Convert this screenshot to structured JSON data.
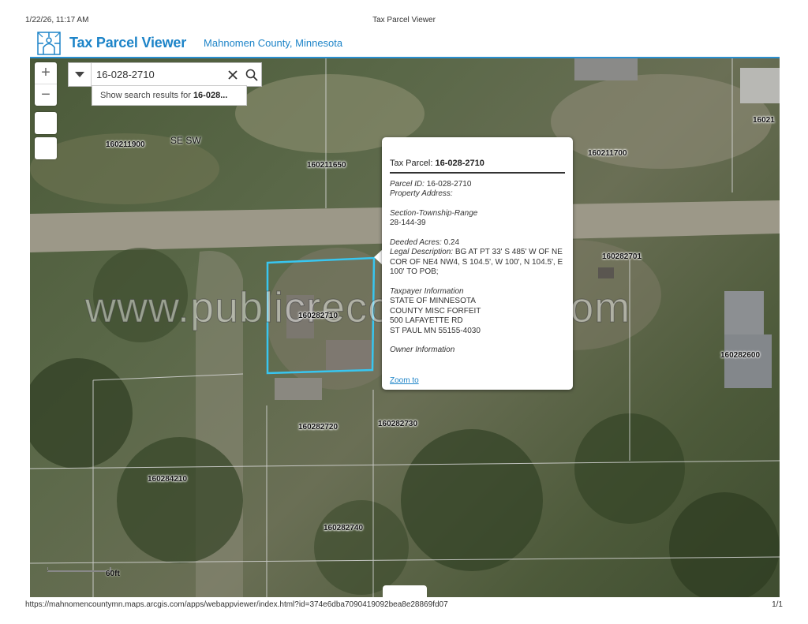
{
  "print": {
    "datetime": "1/22/26, 11:17 AM",
    "title": "Tax Parcel Viewer",
    "url": "https://mahnomencountymn.maps.arcgis.com/apps/webappviewer/index.html?id=374e6dba7090419092bea8e28869fd07",
    "page": "1/1"
  },
  "header": {
    "title": "Tax Parcel Viewer",
    "subtitle": "Mahnomen County, Minnesota",
    "accent": "#1d84c8"
  },
  "map_controls": {
    "zoom_in": "+",
    "zoom_out": "−"
  },
  "search": {
    "value": "16-028-2710",
    "suggestion_prefix": "Show search results for",
    "suggestion_term": "16-028..."
  },
  "map_labels": {
    "section": "SE SW",
    "parcels": [
      "160211900",
      "160211650",
      "160211700",
      "16021",
      "160282701",
      "160282710",
      "160282600",
      "160282720",
      "160282730",
      "160284210",
      "160282740"
    ]
  },
  "watermark": "www.publicrecordsplus.com",
  "scale_label": "60ft",
  "popup": {
    "title_label": "Tax Parcel:",
    "title_value": "16-028-2710",
    "parcel_id_label": "Parcel ID:",
    "parcel_id_value": "16-028-2710",
    "property_address_label": "Property Address:",
    "str_label": "Section-Township-Range",
    "str_value": "28-144-39",
    "acres_label": "Deeded Acres:",
    "acres_value": "0.24",
    "legal_label": "Legal Description:",
    "legal_value": "BG AT PT 33' S 485' W OF NE COR OF NE4 NW4, S 104.5', W 100', N 104.5', E 100' TO POB;",
    "taxpayer_label": "Taxpayer Information",
    "taxpayer_lines": [
      "STATE OF MINNESOTA",
      "COUNTY MISC FORFEIT",
      "500 LAFAYETTE RD",
      "ST PAUL MN 55155-4030"
    ],
    "owner_label": "Owner Information",
    "zoom_link": "Zoom to"
  },
  "colors": {
    "parcel_highlight": "#38c6f0",
    "parcel_lines": "#d8d8d8"
  }
}
